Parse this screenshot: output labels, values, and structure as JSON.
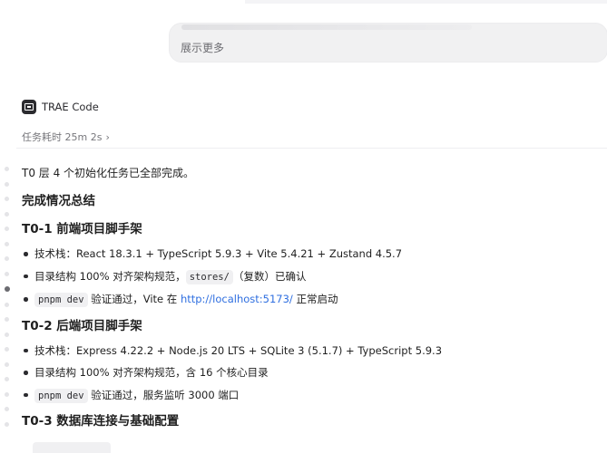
{
  "bubble": {
    "show_more": "展示更多"
  },
  "agent": {
    "name": "TRAE Code",
    "icon": "terminal-icon",
    "duration_label": "任务耗时 25m 2s",
    "chevron": "›"
  },
  "content": {
    "intro": "T0 层 4 个初始化任务已全部完成。",
    "summary_title": "完成情况总结",
    "sections": [
      {
        "title": "T0-1 前端项目脚手架",
        "items": {
          "tech": "技术栈：React 18.3.1 + TypeScript 5.9.3 + Vite 5.4.21 + Zustand 4.5.7",
          "structure_pre": "目录结构 100% 对齐架构规范，",
          "structure_code": "stores/",
          "structure_post": "（复数）已确认",
          "verify_code": "pnpm dev",
          "verify_pre": " 验证通过，Vite 在 ",
          "verify_link": "http://localhost:5173/",
          "verify_post": " 正常启动"
        }
      },
      {
        "title": "T0-2 后端项目脚手架",
        "items": {
          "tech": "技术栈：Express 4.22.2 + Node.js 20 LTS + SQLite 3 (5.1.7) + TypeScript 5.9.3",
          "structure": "目录结构 100% 对齐架构规范，含 16 个核心目录",
          "verify_code": "pnpm dev",
          "verify_post": " 验证通过，服务监听 3000 端口"
        }
      },
      {
        "title": "T0-3 数据库连接与基础配置"
      }
    ]
  },
  "colors": {
    "link": "#2f6fe0",
    "bubble_bg": "#f1f1f2",
    "text": "#1f1f1f",
    "muted": "#77777c"
  }
}
